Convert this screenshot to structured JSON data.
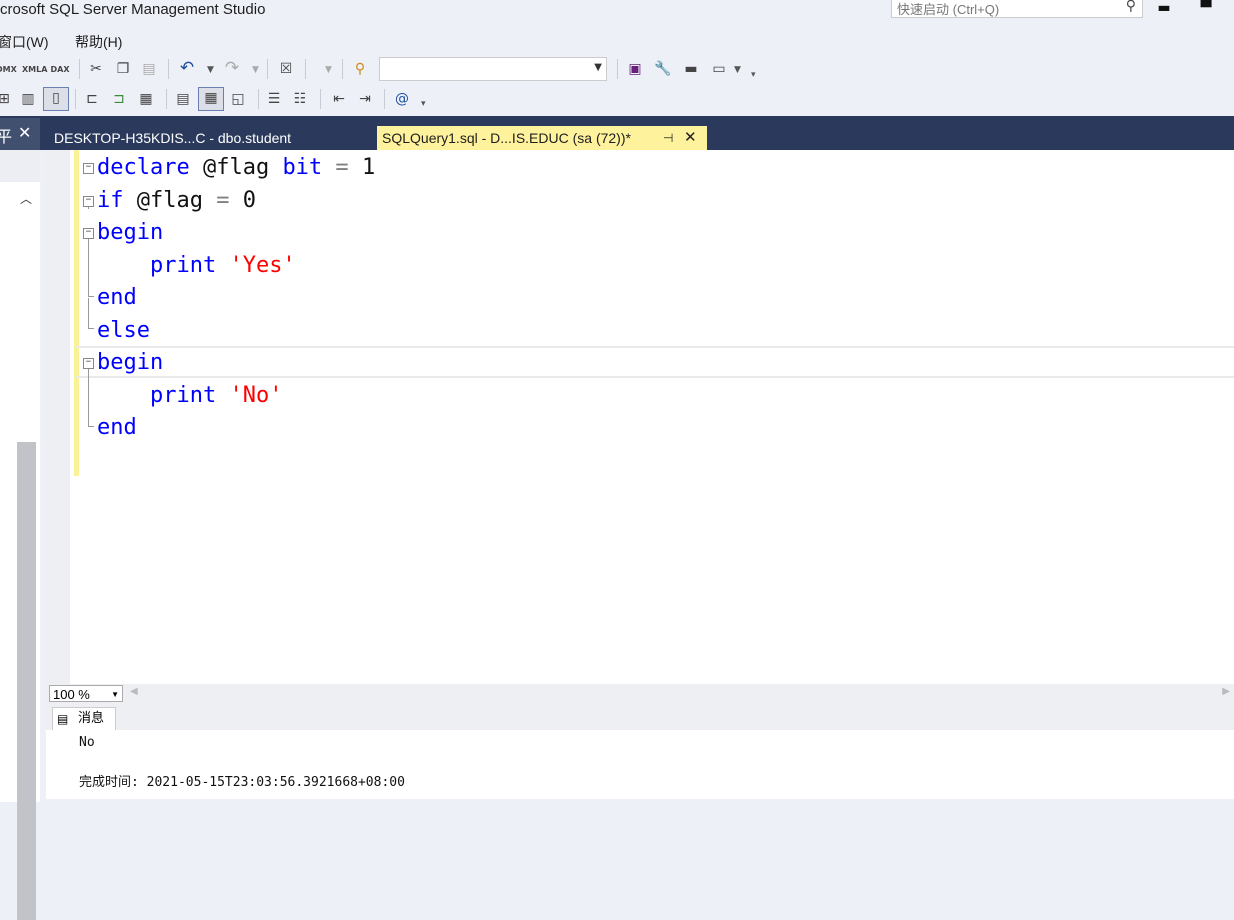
{
  "window": {
    "title": "crosoft SQL Server Management Studio",
    "quick_launch_placeholder": "快速启动 (Ctrl+Q)",
    "minimize": "▬",
    "maximize": "▀"
  },
  "menu": {
    "items": [
      {
        "label": "窗口(W)"
      },
      {
        "label": "帮助(H)"
      }
    ]
  },
  "toolbar1": {
    "dmx_label": "DMX",
    "xmla_label": "XMLA",
    "dax_label": "DAX"
  },
  "tabs": {
    "left_panel_glyph": "平",
    "left_panel_close": "✕",
    "tab1": "DESKTOP-H35KDIS...C - dbo.student",
    "tab2": "SQLQuery1.sql - D...IS.EDUC (sa (72))*",
    "tab2_pin": "⊣",
    "tab2_close": "✕"
  },
  "editor": {
    "lines": [
      [
        {
          "t": "declare",
          "c": "kw"
        },
        {
          "t": " @flag ",
          "c": "id"
        },
        {
          "t": "bit",
          "c": "kw"
        },
        {
          "t": " = ",
          "c": "op"
        },
        {
          "t": "1",
          "c": "id"
        }
      ],
      [
        {
          "t": "if",
          "c": "kw"
        },
        {
          "t": " @flag ",
          "c": "id"
        },
        {
          "t": "=",
          "c": "op"
        },
        {
          "t": " 0",
          "c": "id"
        }
      ],
      [
        {
          "t": "begin",
          "c": "kw"
        }
      ],
      [
        {
          "t": "    print ",
          "c": "kw"
        },
        {
          "t": "'Yes'",
          "c": "str"
        }
      ],
      [
        {
          "t": "end",
          "c": "kw"
        }
      ],
      [
        {
          "t": "else",
          "c": "kw"
        }
      ],
      [
        {
          "t": "begin",
          "c": "kw"
        }
      ],
      [
        {
          "t": "    print ",
          "c": "kw"
        },
        {
          "t": "'No'",
          "c": "str"
        }
      ],
      [
        {
          "t": "end",
          "c": "kw"
        }
      ]
    ],
    "colors": {
      "keyword": "#0000ff",
      "string": "#ff0000",
      "operator": "#808080"
    }
  },
  "zoom": {
    "value": "100 %"
  },
  "results": {
    "tab_label": "消息",
    "message": "No",
    "completion": "完成时间: 2021-05-15T23:03:56.3921668+08:00"
  }
}
